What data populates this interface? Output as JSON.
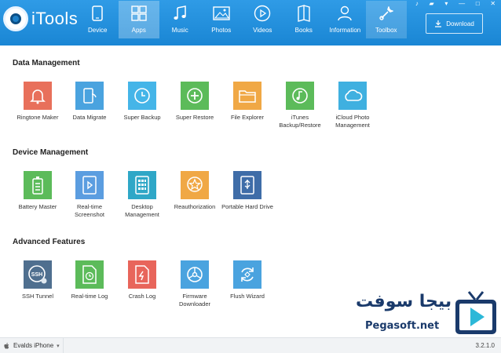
{
  "app": {
    "name": "iTools"
  },
  "nav": [
    {
      "label": "Device",
      "icon": "device-icon"
    },
    {
      "label": "Apps",
      "icon": "apps-icon",
      "active": true
    },
    {
      "label": "Music",
      "icon": "music-icon"
    },
    {
      "label": "Photos",
      "icon": "photos-icon"
    },
    {
      "label": "Videos",
      "icon": "videos-icon"
    },
    {
      "label": "Books",
      "icon": "books-icon"
    },
    {
      "label": "Information",
      "icon": "information-icon"
    },
    {
      "label": "Toolbox",
      "icon": "toolbox-icon"
    }
  ],
  "download_label": "Download",
  "sections": [
    {
      "title": "Data Management",
      "tools": [
        {
          "label": "Ringtone Maker",
          "icon": "bell-icon",
          "color": "#e8705b"
        },
        {
          "label": "Data Migrate",
          "icon": "phone-sync-icon",
          "color": "#4aa3df"
        },
        {
          "label": "Super Backup",
          "icon": "clock-backup-icon",
          "color": "#45b5e8"
        },
        {
          "label": "Super Restore",
          "icon": "plus-restore-icon",
          "color": "#5cbb5a"
        },
        {
          "label": "File Explorer",
          "icon": "folder-icon",
          "color": "#f0a845"
        },
        {
          "label": "iTunes Backup/Restore",
          "icon": "music-note-icon",
          "color": "#5cbb5a"
        },
        {
          "label": "iCloud Photo Management",
          "icon": "cloud-icon",
          "color": "#3fb0e0"
        }
      ]
    },
    {
      "title": "Device Management",
      "tools": [
        {
          "label": "Battery Master",
          "icon": "battery-icon",
          "color": "#5cbb5a"
        },
        {
          "label": "Real-time Screenshot",
          "icon": "play-screen-icon",
          "color": "#5b9de0"
        },
        {
          "label": "Desktop Management",
          "icon": "grid-icon",
          "color": "#2fa7c7"
        },
        {
          "label": "Reauthorization",
          "icon": "badge-star-icon",
          "color": "#f0a845"
        },
        {
          "label": "Portable Hard Drive",
          "icon": "usb-drive-icon",
          "color": "#3f6da8"
        }
      ]
    },
    {
      "title": "Advanced Features",
      "tools": [
        {
          "label": "SSH Tunnel",
          "icon": "ssh-icon",
          "color": "#4f6f8f"
        },
        {
          "label": "Real-time Log",
          "icon": "clock-doc-icon",
          "color": "#5cbb5a"
        },
        {
          "label": "Crash Log",
          "icon": "bolt-doc-icon",
          "color": "#e8655b"
        },
        {
          "label": "Firmware Downloader",
          "icon": "gear-wheel-icon",
          "color": "#4aa3df"
        },
        {
          "label": "Flush Wizard",
          "icon": "refresh-icon",
          "color": "#4aa3df"
        }
      ]
    }
  ],
  "status": {
    "device_name": "Evalds iPhone",
    "version": "3.2.1.0"
  },
  "watermark": {
    "arabic": "بيجا سوفت",
    "domain": "Pegasoft.net"
  }
}
